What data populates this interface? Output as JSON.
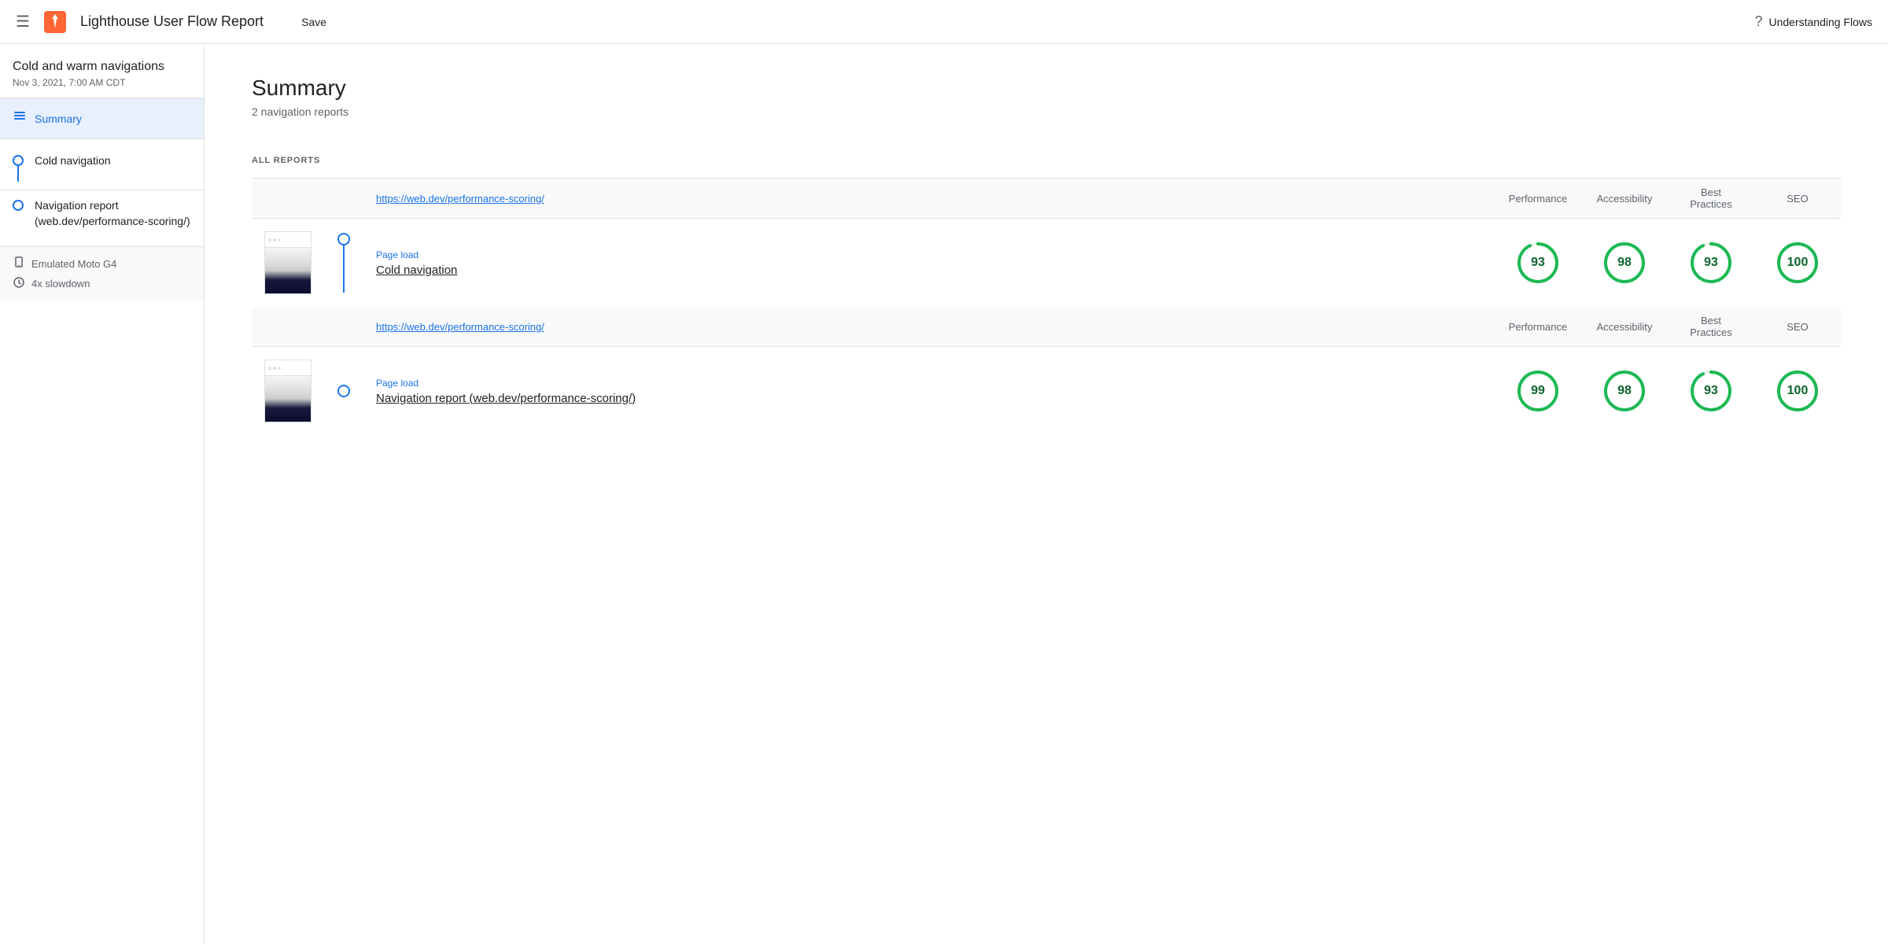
{
  "header": {
    "menu_icon": "☰",
    "app_title": "Lighthouse User Flow Report",
    "save_label": "Save",
    "help_label": "Understanding Flows"
  },
  "sidebar": {
    "project_title": "Cold and warm navigations",
    "project_date": "Nov 3, 2021, 7:00 AM CDT",
    "summary_label": "Summary",
    "nav_items": [
      {
        "label": "Cold navigation",
        "has_line": true
      },
      {
        "label": "Navigation report (web.dev/performance-scoring/)",
        "has_line": false
      }
    ],
    "device_label": "Emulated Moto G4",
    "slowdown_label": "4x slowdown"
  },
  "main": {
    "summary_title": "Summary",
    "summary_subtitle": "2 navigation reports",
    "all_reports_label": "ALL REPORTS",
    "reports": [
      {
        "url": "https://web.dev/performance-scoring/",
        "col_headers": [
          "Performance",
          "Accessibility",
          "Best Practices",
          "SEO"
        ],
        "page_load_label": "Page load",
        "nav_label": "Cold navigation",
        "scores": [
          93,
          98,
          93,
          100
        ]
      },
      {
        "url": "https://web.dev/performance-scoring/",
        "col_headers": [
          "Performance",
          "Accessibility",
          "Best Practices",
          "SEO"
        ],
        "page_load_label": "Page load",
        "nav_label": "Navigation report (web.dev/performance-scoring/)",
        "scores": [
          99,
          98,
          93,
          100
        ]
      }
    ]
  },
  "colors": {
    "accent": "#1a73e8",
    "score_high": "#0d652d",
    "score_ring": "#1db954",
    "score_bg": "#e6f4ea"
  }
}
